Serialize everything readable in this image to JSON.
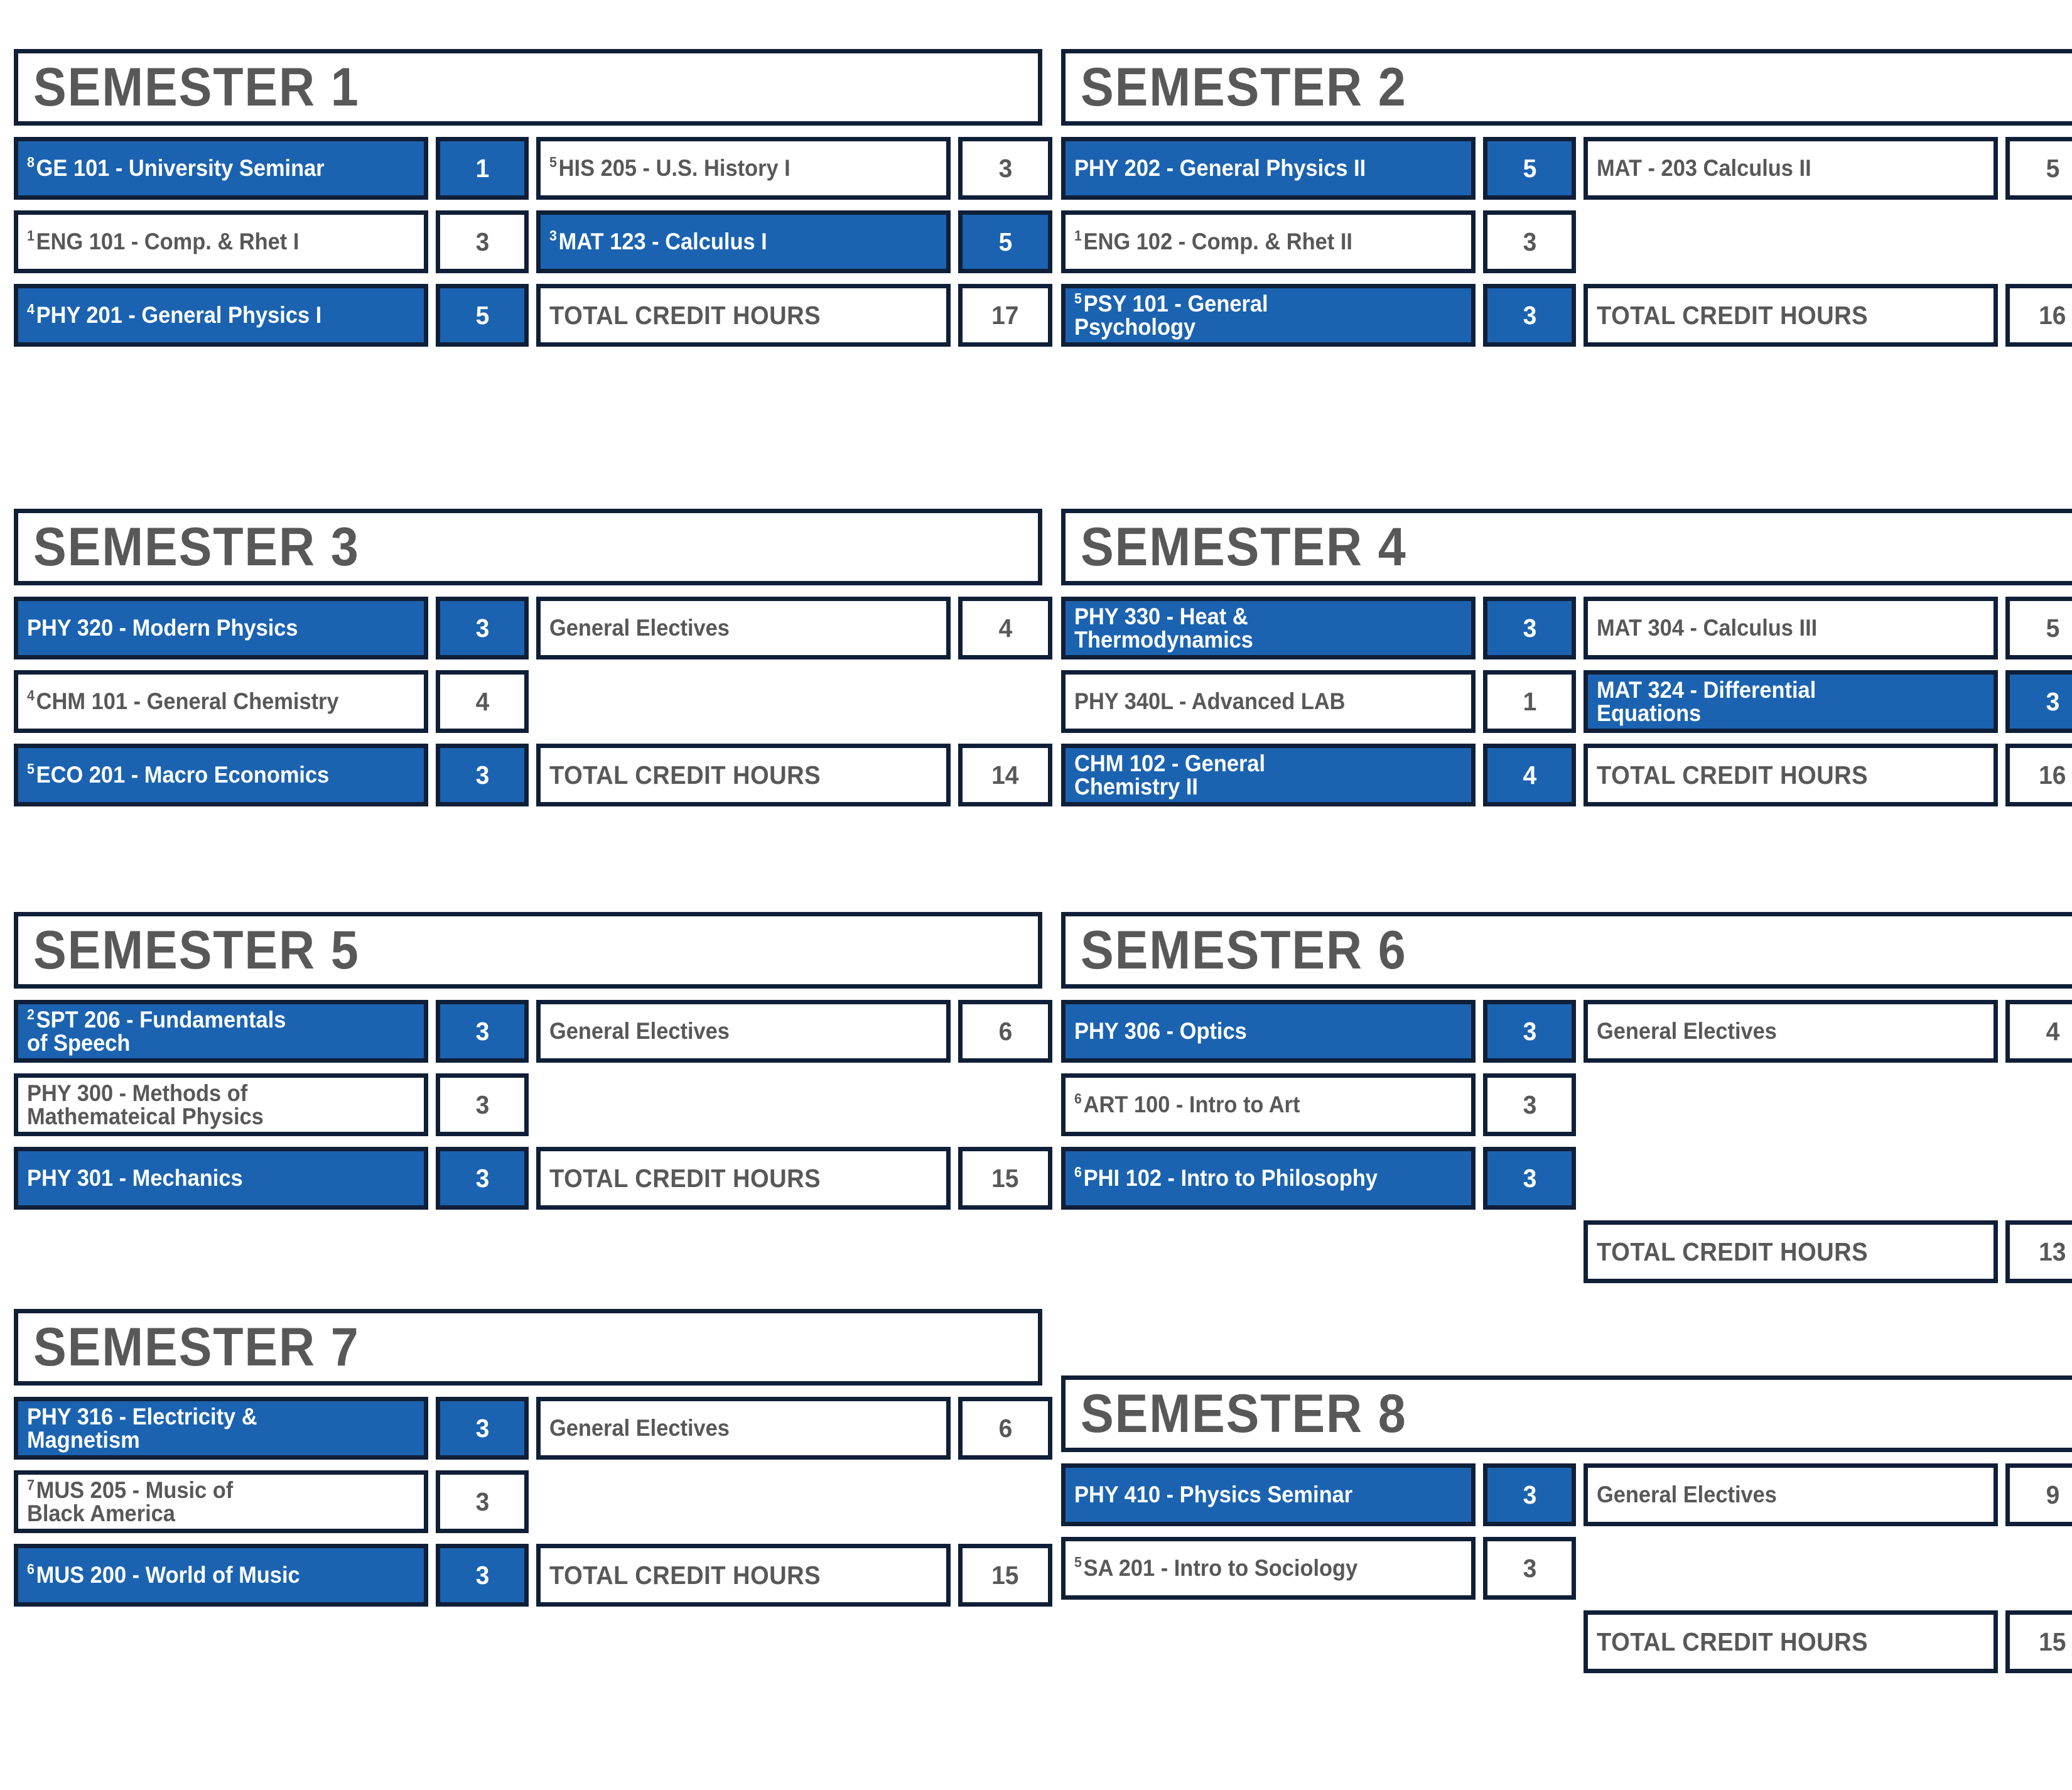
{
  "colors": {
    "accent_blue": "#1b63b0",
    "border_navy": "#101f38",
    "text_gray": "#585858",
    "background": "#ffffff"
  },
  "labels": {
    "total_credit_hours": "TOTAL CREDIT HOURS",
    "general_electives": "General Electives"
  },
  "semesters": [
    {
      "title": "SEMESTER 1",
      "rows": [
        {
          "left": {
            "sup": "8",
            "name": "GE 101 - University Seminar",
            "credits": "1",
            "highlight": true
          },
          "right": {
            "sup": "5",
            "name": "HIS 205 - U.S. History I",
            "credits": "3",
            "highlight": false
          }
        },
        {
          "left": {
            "sup": "1",
            "name": "ENG 101 - Comp. & Rhet I",
            "credits": "3",
            "highlight": false
          },
          "right": {
            "sup": "3",
            "name": "MAT 123 - Calculus I",
            "credits": "5",
            "highlight": true
          }
        },
        {
          "left": {
            "sup": "4",
            "name": "PHY 201 - General Physics I",
            "credits": "5",
            "highlight": true
          },
          "right": {
            "sup": "",
            "name": "TOTAL CREDIT HOURS",
            "credits": "17",
            "highlight": false,
            "is_total": true
          }
        }
      ]
    },
    {
      "title": "SEMESTER 2",
      "rows": [
        {
          "left": {
            "sup": "",
            "name": "PHY 202 - General Physics II",
            "credits": "5",
            "highlight": true
          },
          "right": {
            "sup": "",
            "name": "MAT - 203 Calculus II",
            "credits": "5",
            "highlight": false
          }
        },
        {
          "left": {
            "sup": "1",
            "name": "ENG 102 - Comp. & Rhet II",
            "credits": "3",
            "highlight": false
          },
          "right": {
            "sup": "",
            "name": "",
            "credits": "",
            "highlight": false,
            "empty": true
          }
        },
        {
          "left": {
            "sup": "5",
            "name": "PSY 101 - General\nPsychology",
            "credits": "3",
            "highlight": true
          },
          "right": {
            "sup": "",
            "name": "TOTAL CREDIT HOURS",
            "credits": "16",
            "highlight": false,
            "is_total": true
          }
        }
      ]
    },
    {
      "title": "SEMESTER 3",
      "rows": [
        {
          "left": {
            "sup": "",
            "name": "PHY 320 - Modern Physics",
            "credits": "3",
            "highlight": true
          },
          "right": {
            "sup": "",
            "name": "General Electives",
            "credits": "4",
            "highlight": false
          }
        },
        {
          "left": {
            "sup": "4",
            "name": "CHM 101 - General Chemistry",
            "credits": "4",
            "highlight": false
          },
          "right": {
            "sup": "",
            "name": "",
            "credits": "",
            "highlight": false,
            "empty": true
          }
        },
        {
          "left": {
            "sup": "5",
            "name": "ECO 201 - Macro Economics",
            "credits": "3",
            "highlight": true
          },
          "right": {
            "sup": "",
            "name": "TOTAL CREDIT HOURS",
            "credits": "14",
            "highlight": false,
            "is_total": true
          }
        }
      ]
    },
    {
      "title": "SEMESTER 4",
      "rows": [
        {
          "left": {
            "sup": "",
            "name": "PHY 330 - Heat &\nThermodynamics",
            "credits": "3",
            "highlight": true
          },
          "right": {
            "sup": "",
            "name": "MAT 304 - Calculus III",
            "credits": "5",
            "highlight": false
          }
        },
        {
          "left": {
            "sup": "",
            "name": "PHY 340L - Advanced LAB",
            "credits": "1",
            "highlight": false
          },
          "right": {
            "sup": "",
            "name": "MAT 324 - Differential\nEquations",
            "credits": "3",
            "highlight": true
          }
        },
        {
          "left": {
            "sup": "",
            "name": "CHM 102 - General\nChemistry II",
            "credits": "4",
            "highlight": true
          },
          "right": {
            "sup": "",
            "name": "TOTAL CREDIT HOURS",
            "credits": "16",
            "highlight": false,
            "is_total": true
          }
        }
      ]
    },
    {
      "title": "SEMESTER 5",
      "rows": [
        {
          "left": {
            "sup": "2",
            "name": "SPT 206 - Fundamentals\nof Speech",
            "credits": "3",
            "highlight": true
          },
          "right": {
            "sup": "",
            "name": "General Electives",
            "credits": "6",
            "highlight": false
          }
        },
        {
          "left": {
            "sup": "",
            "name": "PHY 300 - Methods of\nMathemateical Physics",
            "credits": "3",
            "highlight": false
          },
          "right": {
            "sup": "",
            "name": "",
            "credits": "",
            "highlight": false,
            "empty": true
          }
        },
        {
          "left": {
            "sup": "",
            "name": "PHY 301 - Mechanics",
            "credits": "3",
            "highlight": true
          },
          "right": {
            "sup": "",
            "name": "TOTAL CREDIT HOURS",
            "credits": "15",
            "highlight": false,
            "is_total": true
          }
        }
      ]
    },
    {
      "title": "SEMESTER 6",
      "rows": [
        {
          "left": {
            "sup": "",
            "name": "PHY 306 - Optics",
            "credits": "3",
            "highlight": true
          },
          "right": {
            "sup": "",
            "name": "General Electives",
            "credits": "4",
            "highlight": false
          }
        },
        {
          "left": {
            "sup": "6",
            "name": "ART 100 - Intro to Art",
            "credits": "3",
            "highlight": false
          },
          "right": {
            "sup": "",
            "name": "",
            "credits": "",
            "highlight": false,
            "empty": true
          }
        },
        {
          "left": {
            "sup": "6",
            "name": "PHI 102 - Intro to Philosophy",
            "credits": "3",
            "highlight": true
          },
          "right": {
            "sup": "",
            "name": "",
            "credits": "",
            "highlight": false,
            "empty": true
          }
        },
        {
          "left": {
            "sup": "",
            "name": "",
            "credits": "",
            "highlight": false,
            "empty": true
          },
          "right": {
            "sup": "",
            "name": "TOTAL CREDIT HOURS",
            "credits": "13",
            "highlight": false,
            "is_total": true
          }
        }
      ]
    },
    {
      "title": "SEMESTER 7",
      "rows": [
        {
          "left": {
            "sup": "",
            "name": "PHY 316 - Electricity &\nMagnetism",
            "credits": "3",
            "highlight": true
          },
          "right": {
            "sup": "",
            "name": "General Electives",
            "credits": "6",
            "highlight": false
          }
        },
        {
          "left": {
            "sup": "7",
            "name": "MUS 205 - Music of\nBlack America",
            "credits": "3",
            "highlight": false
          },
          "right": {
            "sup": "",
            "name": "",
            "credits": "",
            "highlight": false,
            "empty": true
          }
        },
        {
          "left": {
            "sup": "6",
            "name": "MUS 200 - World of Music",
            "credits": "3",
            "highlight": true
          },
          "right": {
            "sup": "",
            "name": "TOTAL CREDIT HOURS",
            "credits": "15",
            "highlight": false,
            "is_total": true
          }
        }
      ]
    },
    {
      "title": "SEMESTER 8",
      "rows": [
        {
          "left": {
            "sup": "",
            "name": "PHY 410 - Physics Seminar",
            "credits": "3",
            "highlight": true
          },
          "right": {
            "sup": "",
            "name": "General Electives",
            "credits": "9",
            "highlight": false
          }
        },
        {
          "left": {
            "sup": "5",
            "name": "SA 201 - Intro to Sociology",
            "credits": "3",
            "highlight": false
          },
          "right": {
            "sup": "",
            "name": "",
            "credits": "",
            "highlight": false,
            "empty": true
          }
        },
        {
          "left": {
            "sup": "",
            "name": "",
            "credits": "",
            "highlight": false,
            "empty": true
          },
          "right": {
            "sup": "",
            "name": "TOTAL CREDIT HOURS",
            "credits": "15",
            "highlight": false,
            "is_total": true
          }
        }
      ]
    }
  ]
}
